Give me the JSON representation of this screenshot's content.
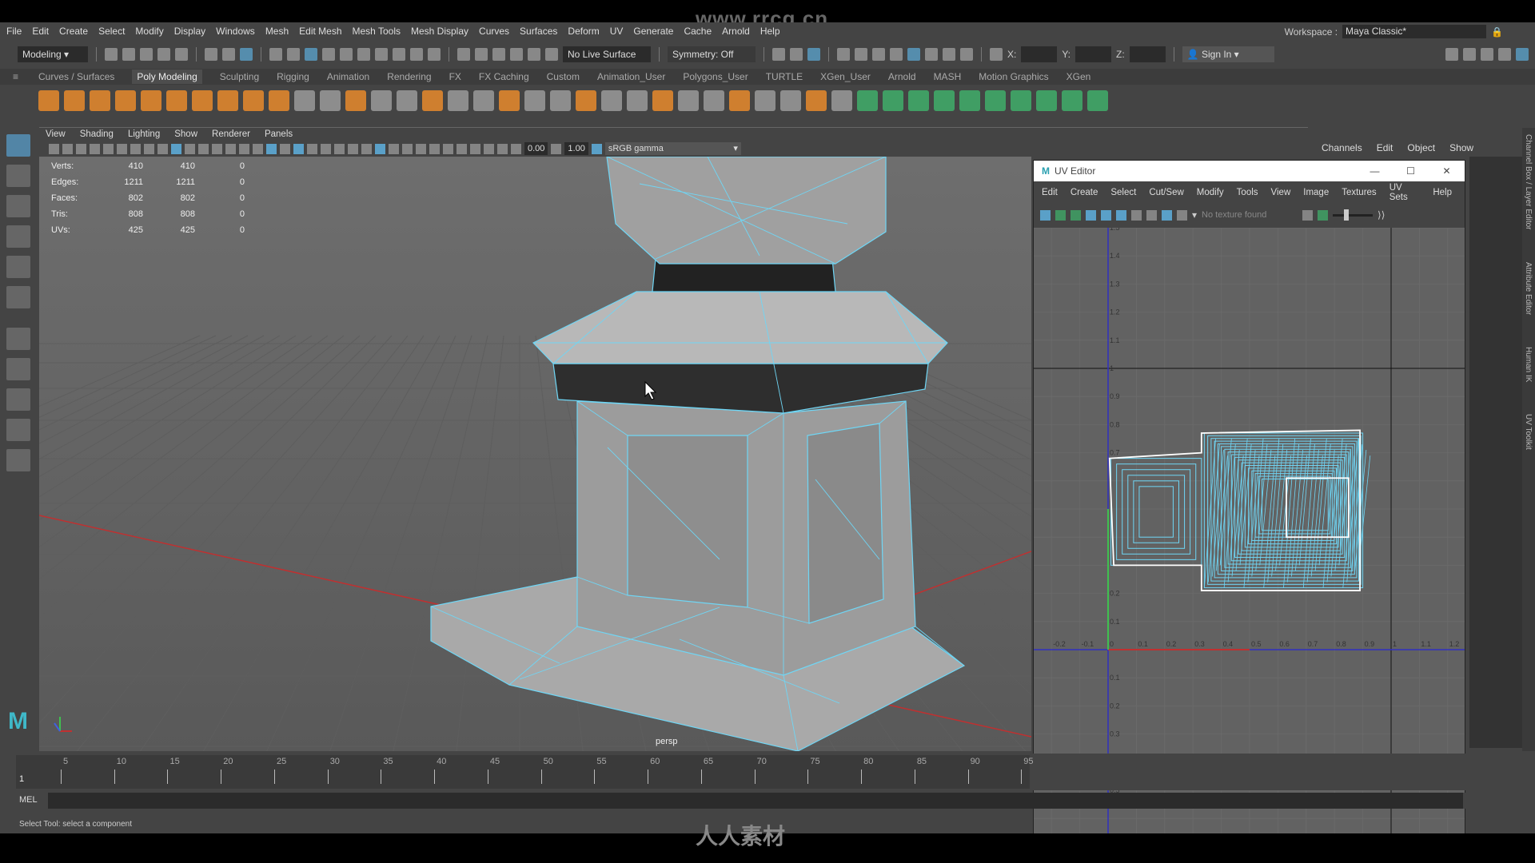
{
  "watermark": {
    "url": "www.rrcg.cn",
    "logo": "人人素材"
  },
  "menubar": [
    "File",
    "Edit",
    "Create",
    "Select",
    "Modify",
    "Display",
    "Windows",
    "Mesh",
    "Edit Mesh",
    "Mesh Tools",
    "Mesh Display",
    "Curves",
    "Surfaces",
    "Deform",
    "UV",
    "Generate",
    "Cache",
    "Arnold",
    "Help"
  ],
  "workspace": {
    "label": "Workspace :",
    "value": "Maya Classic*"
  },
  "status": {
    "mode": "Modeling",
    "live_surface": "No Live Surface",
    "symmetry": "Symmetry: Off",
    "x_label": "X:",
    "y_label": "Y:",
    "z_label": "Z:",
    "sign_in": "Sign In"
  },
  "shelf_tabs": [
    "Curves / Surfaces",
    "Poly Modeling",
    "Sculpting",
    "Rigging",
    "Animation",
    "Rendering",
    "FX",
    "FX Caching",
    "Custom",
    "Animation_User",
    "Polygons_User",
    "TURTLE",
    "XGen_User",
    "Arnold",
    "MASH",
    "Motion Graphics",
    "XGen"
  ],
  "shelf_active": "Poly Modeling",
  "colors": {
    "accent": "#5285a6",
    "wire": "#6fd6f5",
    "shelf_orange": "#e8892b",
    "shelf_green": "#3fae6a",
    "x_axis": "#c03030",
    "y_axis": "#3fc050",
    "uv_v_axis": "#3030c0"
  },
  "viewport": {
    "menu": [
      "View",
      "Shading",
      "Lighting",
      "Show",
      "Renderer",
      "Panels"
    ],
    "exposure": "0.00",
    "gamma": "1.00",
    "color_space": "sRGB gamma",
    "camera": "persp",
    "hud": [
      {
        "label": "Verts:",
        "a": "410",
        "b": "410",
        "c": "0"
      },
      {
        "label": "Edges:",
        "a": "1211",
        "b": "1211",
        "c": "0"
      },
      {
        "label": "Faces:",
        "a": "802",
        "b": "802",
        "c": "0"
      },
      {
        "label": "Tris:",
        "a": "808",
        "b": "808",
        "c": "0"
      },
      {
        "label": "UVs:",
        "a": "425",
        "b": "425",
        "c": "0"
      }
    ]
  },
  "uv_editor": {
    "title": "UV Editor",
    "menu": [
      "Edit",
      "Create",
      "Select",
      "Cut/Sew",
      "Modify",
      "Tools",
      "View",
      "Image",
      "Textures",
      "UV Sets",
      "Help"
    ],
    "texture_status": "No texture found",
    "u_ticks": [
      "-0.2",
      "-0.1",
      "0",
      "0.1",
      "0.2",
      "0.3",
      "0.4",
      "0.5",
      "0.6",
      "0.7",
      "0.8",
      "0.9",
      "1",
      "1.1",
      "1.2"
    ],
    "v_ticks": [
      "1.5",
      "1.4",
      "1.3",
      "1.2",
      "1.1",
      "1",
      "0.9",
      "0.8",
      "0.7",
      "0.2",
      "0.1",
      "0.1",
      "0.2",
      "0.3",
      "0.4",
      "0.5"
    ]
  },
  "channel_box": {
    "menu": [
      "Channels",
      "Edit",
      "Object",
      "Show"
    ],
    "side_tabs": [
      "Channel Box / Layer Editor",
      "Attribute Editor",
      "Human IK",
      "UV Toolkit"
    ]
  },
  "timeline": {
    "current": "1",
    "ticks": [
      "5",
      "10",
      "15",
      "20",
      "25",
      "30",
      "35",
      "40",
      "45",
      "50",
      "55",
      "60",
      "65",
      "70",
      "75",
      "80",
      "85",
      "90",
      "95"
    ]
  },
  "command": {
    "label": "MEL"
  },
  "status_line": "Select Tool: select a component"
}
